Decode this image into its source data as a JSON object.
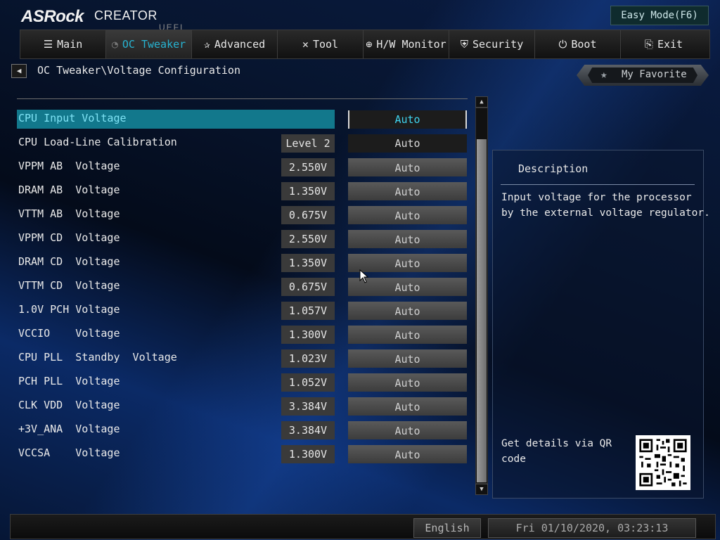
{
  "brand": {
    "asrock": "ASRock",
    "creator": "CREATOR",
    "uefi": "UEFI"
  },
  "easy_mode_label": "Easy Mode(F6)",
  "tabs": [
    {
      "label": "Main",
      "icon": "list-icon",
      "active": false
    },
    {
      "label": "OC Tweaker",
      "icon": "meter-icon",
      "active": true
    },
    {
      "label": "Advanced",
      "icon": "star-tool-icon",
      "active": false
    },
    {
      "label": "Tool",
      "icon": "tools-icon",
      "active": false
    },
    {
      "label": "H/W Monitor",
      "icon": "monitor-icon",
      "active": false
    },
    {
      "label": "Security",
      "icon": "shield-icon",
      "active": false
    },
    {
      "label": "Boot",
      "icon": "power-icon",
      "active": false
    },
    {
      "label": "Exit",
      "icon": "exit-icon",
      "active": false
    }
  ],
  "breadcrumb": "OC Tweaker\\Voltage Configuration",
  "favorite_label": "My Favorite",
  "settings": [
    {
      "name": "CPU Input Voltage",
      "current": "",
      "value": "Auto"
    },
    {
      "name": "CPU Load-Line Calibration",
      "current": "Level 2",
      "value": "Auto"
    },
    {
      "name": "VPPM AB  Voltage",
      "current": "2.550V",
      "value": "Auto"
    },
    {
      "name": "DRAM AB  Voltage",
      "current": "1.350V",
      "value": "Auto"
    },
    {
      "name": "VTTM AB  Voltage",
      "current": "0.675V",
      "value": "Auto"
    },
    {
      "name": "VPPM CD  Voltage",
      "current": "2.550V",
      "value": "Auto"
    },
    {
      "name": "DRAM CD  Voltage",
      "current": "1.350V",
      "value": "Auto"
    },
    {
      "name": "VTTM CD  Voltage",
      "current": "0.675V",
      "value": "Auto"
    },
    {
      "name": "1.0V PCH Voltage",
      "current": "1.057V",
      "value": "Auto"
    },
    {
      "name": "VCCIO    Voltage",
      "current": "1.300V",
      "value": "Auto"
    },
    {
      "name": "CPU PLL  Standby  Voltage",
      "current": "1.023V",
      "value": "Auto"
    },
    {
      "name": "PCH PLL  Voltage",
      "current": "1.052V",
      "value": "Auto"
    },
    {
      "name": "CLK VDD  Voltage",
      "current": "3.384V",
      "value": "Auto"
    },
    {
      "name": "+3V_ANA  Voltage",
      "current": "3.384V",
      "value": "Auto"
    },
    {
      "name": "VCCSA    Voltage",
      "current": "1.300V",
      "value": "Auto"
    }
  ],
  "description": {
    "title": "Description",
    "text": "Input voltage for the processor\nby the external voltage regulator.",
    "qr_text": "Get details via QR\ncode"
  },
  "footer": {
    "language": "English",
    "datetime": "Fri 01/10/2020, 03:23:13"
  },
  "colors": {
    "accent": "#27b3d1",
    "selected_row": "#12788c"
  }
}
